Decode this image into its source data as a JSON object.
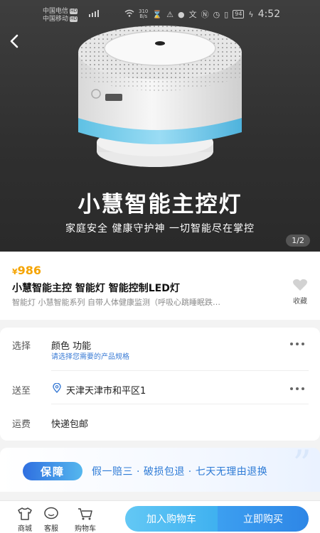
{
  "status_bar": {
    "carrier1": "中国电信",
    "carrier2": "中国移动",
    "hd": "HD",
    "net_speed": "310",
    "net_unit": "B/s",
    "battery": "94",
    "time": "4:52"
  },
  "hero": {
    "title": "小慧智能主控灯",
    "subtitle": "家庭安全 健康守护神 一切智能尽在掌控",
    "pager": "1/2"
  },
  "product": {
    "currency": "¥",
    "price": "986",
    "name": "小慧智能主控 智能灯 智能控制LED灯",
    "desc": "智能灯 小慧智能系列 自带人体健康监测（呼吸心跳睡眠跌…",
    "fav_label": "收藏"
  },
  "options": {
    "select_label": "选择",
    "select_value": "颜色 功能",
    "select_hint": "请选择您需要的产品规格",
    "ship_label": "送至",
    "ship_value": "天津天津市和平区1",
    "freight_label": "运费",
    "freight_value": "快递包邮"
  },
  "guarantee": {
    "badge": "保障",
    "text": "假一赔三 · 破损包退 · 七天无理由退换"
  },
  "bottom": {
    "shop": "商城",
    "service": "客服",
    "cart": "购物车",
    "add_cart": "加入购物车",
    "buy_now": "立即购买"
  },
  "colors": {
    "price": "#f5a400",
    "accent_blue": "#2e86e6",
    "link_blue": "#3a7bd5"
  }
}
